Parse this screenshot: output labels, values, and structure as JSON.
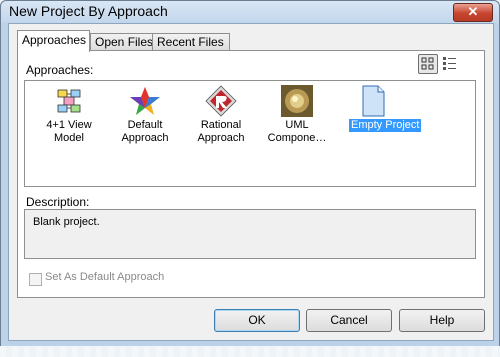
{
  "window": {
    "title": "New Project By Approach",
    "close_label": "✕"
  },
  "tabs": [
    {
      "label": "Approaches"
    },
    {
      "label": "Open Files"
    },
    {
      "label": "Recent Files"
    }
  ],
  "approaches_label": "Approaches:",
  "view_modes": [
    "large-icons-view-icon",
    "details-view-icon"
  ],
  "items": [
    {
      "line1": "4+1 View",
      "line2": "Model",
      "icon": "view-model-icon",
      "selected": false
    },
    {
      "line1": "Default",
      "line2": "Approach",
      "icon": "star-icon",
      "selected": false
    },
    {
      "line1": "Rational",
      "line2": "Approach",
      "icon": "rational-icon",
      "selected": false
    },
    {
      "line1": "UML",
      "line2": "Compone…",
      "icon": "uml-component-icon",
      "selected": false
    },
    {
      "line1": "Empty Project",
      "line2": "",
      "icon": "document-icon",
      "selected": true
    }
  ],
  "description_label": "Description:",
  "description_text": "Blank project.",
  "default_checkbox_label": "Set As Default Approach",
  "buttons": {
    "ok": "OK",
    "cancel": "Cancel",
    "help": "Help"
  },
  "colors": {
    "selection": "#3399ff",
    "close": "#c8452f"
  }
}
